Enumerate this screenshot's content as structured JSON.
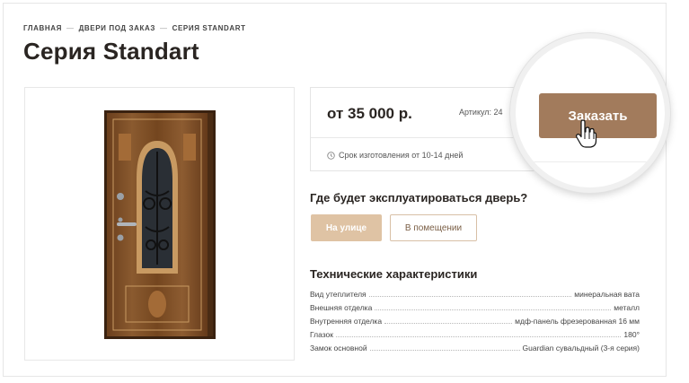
{
  "breadcrumb": {
    "items": [
      "ГЛАВНАЯ",
      "ДВЕРИ ПОД ЗАКАЗ",
      "СЕРИЯ STANDART"
    ],
    "separator": "—"
  },
  "page_title": "Серия Standart",
  "product": {
    "price": "от 35 000 р.",
    "article": "Артикул: 24",
    "lead_time": "Срок изготовления от 10-14 дней",
    "order_button": "Заказать"
  },
  "usage": {
    "question": "Где будет эксплуатироваться дверь?",
    "options": [
      "На улице",
      "В помещении"
    ],
    "selected": "На улице"
  },
  "specs": {
    "title": "Технические характеристики",
    "rows": [
      {
        "name": "Вид утеплителя",
        "value": "минеральная вата"
      },
      {
        "name": "Внешняя отделка",
        "value": "металл"
      },
      {
        "name": "Внутренняя отделка",
        "value": "мдф-панель фрезерованная 16 мм"
      },
      {
        "name": "Глазок",
        "value": "180°"
      },
      {
        "name": "Замок основной",
        "value": "Guardian сувальдный (3-я серия)"
      }
    ]
  },
  "colors": {
    "accent": "#a27b5c",
    "selected_option": "#dfc3a4",
    "door_wood": "#7e4d24"
  },
  "icons": [
    "clock-icon",
    "hand-cursor-icon"
  ]
}
